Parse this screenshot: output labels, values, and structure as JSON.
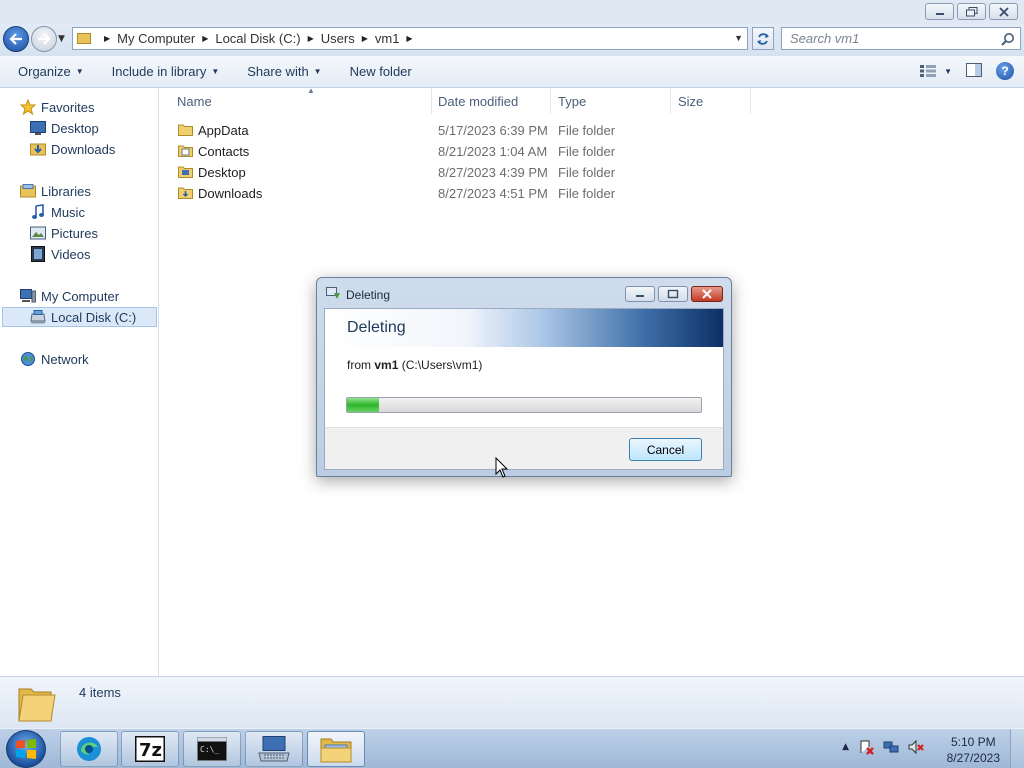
{
  "window": {
    "caption_buttons": [
      "minimize",
      "restore",
      "close"
    ]
  },
  "address": {
    "crumbs": [
      "My Computer",
      "Local Disk (C:)",
      "Users",
      "vm1"
    ],
    "search_placeholder": "Search vm1"
  },
  "toolbar": {
    "organize": "Organize",
    "include_in_library": "Include in library",
    "share_with": "Share with",
    "new_folder": "New folder"
  },
  "navpane": {
    "favorites": "Favorites",
    "fav_items": [
      "Desktop",
      "Downloads"
    ],
    "libraries": "Libraries",
    "lib_items": [
      "Music",
      "Pictures",
      "Videos"
    ],
    "my_computer": "My Computer",
    "local_disk": "Local Disk (C:)",
    "network": "Network"
  },
  "columns": [
    "Name",
    "Date modified",
    "Type",
    "Size"
  ],
  "files": [
    {
      "name": "AppData",
      "date": "5/17/2023 6:39 PM",
      "type": "File folder",
      "icon": "folder-icon"
    },
    {
      "name": "Contacts",
      "date": "8/21/2023 1:04 AM",
      "type": "File folder",
      "icon": "contacts-folder-icon"
    },
    {
      "name": "Desktop",
      "date": "8/27/2023 4:39 PM",
      "type": "File folder",
      "icon": "desktop-folder-icon"
    },
    {
      "name": "Downloads",
      "date": "8/27/2023 4:51 PM",
      "type": "File folder",
      "icon": "downloads-folder-icon"
    }
  ],
  "details": {
    "item_count": "4 items"
  },
  "dialog": {
    "title": "Deleting",
    "heading": "Deleting",
    "from_prefix": "from ",
    "from_name": "vm1",
    "from_path": " (C:\\Users\\vm1)",
    "progress_percent": 9,
    "cancel": "Cancel"
  },
  "taskbar": {
    "pinned": [
      "edge-icon",
      "7zip-icon",
      "cmd-icon",
      "keyboard-icon",
      "explorer-icon"
    ],
    "time": "5:10 PM",
    "date": "8/27/2023"
  },
  "colors": {
    "accent": "#1e395b",
    "progress": "#2fb52a",
    "close": "#c23a24"
  }
}
